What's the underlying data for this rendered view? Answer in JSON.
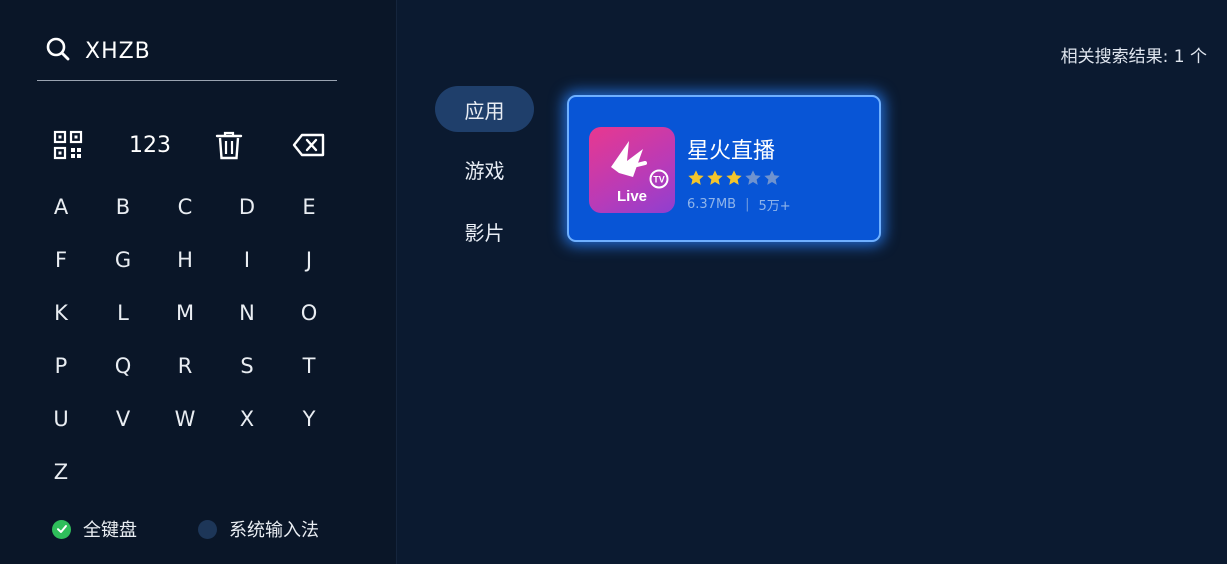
{
  "search": {
    "query": "XHZB"
  },
  "function_keys": {
    "num": "123"
  },
  "keys": [
    "A",
    "B",
    "C",
    "D",
    "E",
    "F",
    "G",
    "H",
    "I",
    "J",
    "K",
    "L",
    "M",
    "N",
    "O",
    "P",
    "Q",
    "R",
    "S",
    "T",
    "U",
    "V",
    "W",
    "X",
    "Y",
    "Z"
  ],
  "ime": {
    "full": "全键盘",
    "system": "系统输入法",
    "active": "full"
  },
  "results": {
    "count_label": "相关搜索结果: 1 个"
  },
  "categories": [
    {
      "label": "应用",
      "active": true
    },
    {
      "label": "游戏",
      "active": false
    },
    {
      "label": "影片",
      "active": false
    }
  ],
  "app": {
    "name": "星火直播",
    "icon_text": "Live",
    "rating": 3,
    "rating_max": 5,
    "size": "6.37MB",
    "downloads": "5万+"
  },
  "colors": {
    "accent": "#0855d6",
    "star_on": "#f3c52c",
    "star_off": "#6f93cf",
    "check_green": "#2fbf5b"
  }
}
